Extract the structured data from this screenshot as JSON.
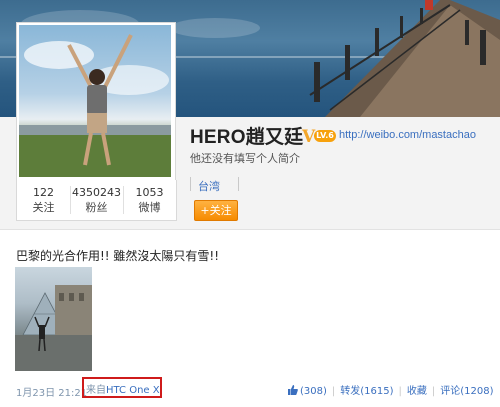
{
  "profile": {
    "name": "HERO趙又廷",
    "verified_mark": "V",
    "level_badge": "LV.6",
    "url": "http://weibo.com/mastachao",
    "bio": "他还没有填写个人简介",
    "location": "台湾",
    "follow_label": "+关注"
  },
  "stats": [
    {
      "value": "122",
      "label": "关注"
    },
    {
      "value": "4350243",
      "label": "粉丝"
    },
    {
      "value": "1053",
      "label": "微博"
    }
  ],
  "post": {
    "text": "巴黎的光合作用!! 雖然沒太陽只有雪!!",
    "time": "1月23日 21:21",
    "source_prefix": "来自",
    "source_app": "HTC One X",
    "likes": "(308)",
    "repost": "转发(1615)",
    "favorite": "收藏",
    "comment": "评论(1208)"
  },
  "colors": {
    "accent_link": "#3a6fbf",
    "follow_orange": "#f68b00",
    "highlight_red": "#cf1b1b",
    "verified_gold": "#f3a62a"
  },
  "icons": [
    "thumbs-up-icon",
    "verified-v-icon",
    "level-badge-icon"
  ]
}
